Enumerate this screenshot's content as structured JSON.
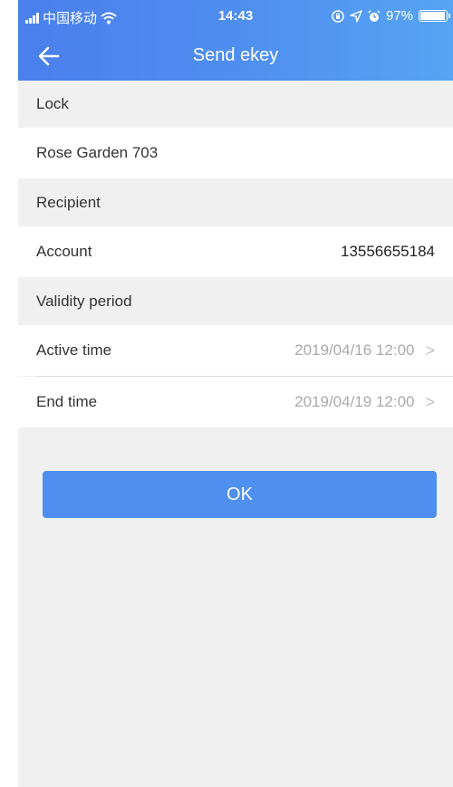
{
  "status_bar": {
    "carrier": "中国移动",
    "time": "14:43",
    "battery": "97%",
    "battery_level": 0.97
  },
  "nav": {
    "title": "Send ekey",
    "back_icon": "arrow-left-icon"
  },
  "sections": {
    "lock": "Lock",
    "recipient": "Recipient",
    "validity": "Validity period"
  },
  "lock_name": "Rose Garden 703",
  "account": {
    "label": "Account",
    "value": "13556655184"
  },
  "active_time": {
    "label": "Active time",
    "value": "2019/04/16 12:00"
  },
  "end_time": {
    "label": "End time",
    "value": "2019/04/19 12:00"
  },
  "ok_button": "OK",
  "colors": {
    "header_blue": "#4f8ef0",
    "button_blue": "#4f8ff0",
    "background": "#f0f0f0"
  }
}
